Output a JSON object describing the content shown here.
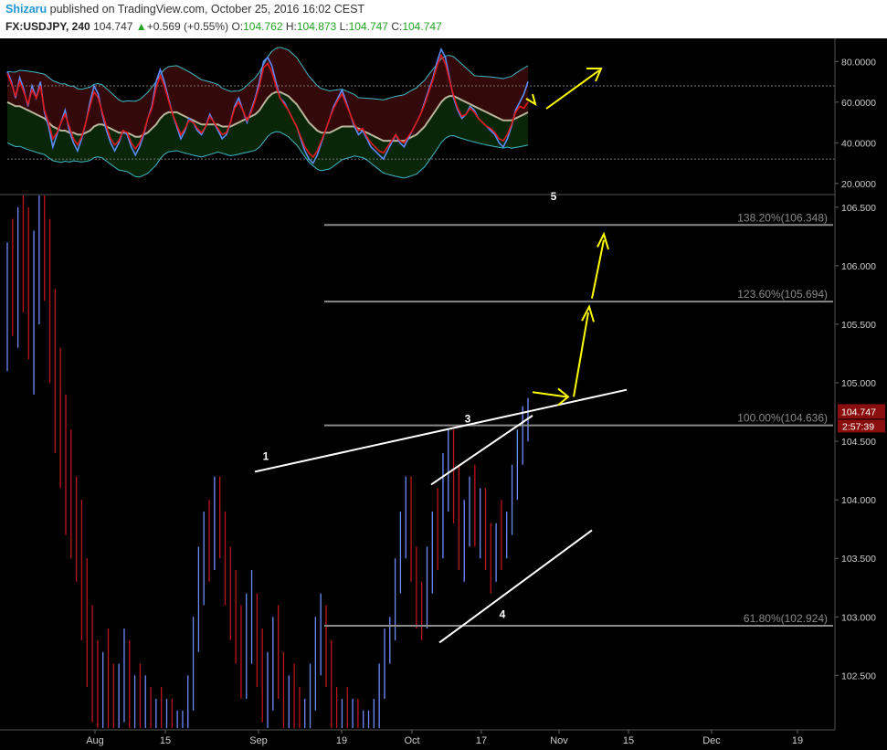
{
  "header": {
    "author": "Shizaru",
    "published_text": "published on TradingView.com, October 25, 2016 16:02 CEST",
    "symbol": "FX:USDJPY, 240",
    "last": "104.747",
    "change": "+0.569 (+0.55%)",
    "o_label": "O:",
    "o_value": "104.762",
    "h_label": "H:",
    "h_value": "104.873",
    "l_label": "L:",
    "l_value": "104.747",
    "c_label": "C:",
    "c_value": "104.747"
  },
  "chart_data": [
    {
      "type": "line",
      "description_none": "",
      "y_ticks": [
        "80.0000",
        "60.0000",
        "40.0000",
        "20.0000"
      ],
      "ylim": [
        15,
        90
      ],
      "levels": [
        68,
        32
      ],
      "series": [
        {
          "values": [
            75,
            70,
            62,
            72,
            66,
            58,
            68,
            62,
            70,
            55,
            48,
            38,
            44,
            50,
            56,
            46,
            40,
            36,
            42,
            50,
            60,
            68,
            64,
            54,
            46,
            40,
            36,
            40,
            46,
            44,
            38,
            34,
            38,
            44,
            52,
            58,
            70,
            76,
            70,
            62,
            54,
            48,
            42,
            46,
            52,
            50,
            46,
            44,
            48,
            54,
            50,
            46,
            42,
            44,
            50,
            58,
            62,
            56,
            50,
            56,
            62,
            70,
            80,
            82,
            78,
            70,
            62,
            60,
            56,
            52,
            48,
            42,
            36,
            32,
            30,
            34,
            40,
            46,
            52,
            58,
            62,
            66,
            60,
            54,
            48,
            44,
            46,
            42,
            38,
            36,
            34,
            32,
            36,
            40,
            44,
            40,
            38,
            42,
            46,
            50,
            54,
            60,
            66,
            72,
            80,
            86,
            82,
            72,
            62,
            56,
            52,
            54,
            58,
            56,
            52,
            50,
            48,
            46,
            44,
            40,
            38,
            42,
            48,
            56,
            60,
            64,
            70
          ]
        },
        {
          "values": [
            74,
            69,
            63,
            70,
            65,
            59,
            66,
            62,
            68,
            56,
            50,
            42,
            45,
            50,
            54,
            48,
            42,
            39,
            43,
            50,
            58,
            65,
            62,
            55,
            48,
            42,
            39,
            41,
            46,
            45,
            40,
            37,
            40,
            45,
            52,
            57,
            67,
            73,
            68,
            61,
            54,
            49,
            44,
            47,
            51,
            50,
            47,
            45,
            48,
            53,
            50,
            47,
            44,
            45,
            50,
            57,
            60,
            56,
            51,
            55,
            61,
            68,
            77,
            79,
            75,
            68,
            62,
            59,
            56,
            52,
            48,
            43,
            38,
            35,
            33,
            36,
            41,
            46,
            52,
            57,
            61,
            64,
            59,
            54,
            49,
            46,
            47,
            43,
            40,
            38,
            36,
            35,
            38,
            41,
            44,
            41,
            40,
            43,
            46,
            50,
            54,
            59,
            65,
            71,
            78,
            83,
            79,
            71,
            63,
            57,
            53,
            54,
            57,
            55,
            52,
            50,
            48,
            47,
            45,
            42,
            41,
            44,
            49,
            55,
            58,
            57,
            60
          ]
        },
        {
          "values": [
            60,
            59,
            58,
            58,
            57,
            56,
            55,
            54,
            53,
            52,
            50,
            48,
            47,
            46,
            46,
            45,
            45,
            44,
            44,
            45,
            46,
            48,
            49,
            49,
            48,
            47,
            46,
            45,
            45,
            45,
            44,
            43,
            43,
            44,
            45,
            47,
            49,
            52,
            54,
            55,
            55,
            55,
            54,
            53,
            52,
            51,
            50,
            49,
            49,
            49,
            49,
            49,
            48,
            48,
            48,
            49,
            50,
            51,
            52,
            53,
            54,
            56,
            59,
            62,
            64,
            65,
            65,
            64,
            63,
            61,
            59,
            56,
            53,
            50,
            48,
            46,
            45,
            45,
            45,
            46,
            47,
            48,
            48,
            48,
            48,
            47,
            46,
            45,
            44,
            43,
            42,
            41,
            41,
            41,
            41,
            41,
            41,
            42,
            43,
            44,
            46,
            48,
            51,
            54,
            57,
            60,
            62,
            63,
            63,
            62,
            61,
            60,
            59,
            58,
            57,
            56,
            55,
            54,
            53,
            52,
            51,
            51,
            51,
            52,
            53,
            54,
            55
          ]
        }
      ]
    },
    {
      "type": "bar",
      "subtype": "ohlc",
      "x_ticks": [
        "Aug",
        "15",
        "Sep",
        "19",
        "Oct",
        "17",
        "Nov",
        "15",
        "Dec",
        "19"
      ],
      "y_ticks": [
        "106.500",
        "106.000",
        "105.500",
        "105.000",
        "104.500",
        "104.000",
        "103.500",
        "103.000",
        "102.500"
      ],
      "ylim": [
        102.05,
        106.6
      ],
      "last_price_label": "104.747",
      "countdown_label": "2:57:39",
      "wave_labels": [
        "1",
        "3",
        "4",
        "5"
      ],
      "fib_levels": [
        {
          "label": "138.20%(106.348)",
          "value": 106.348
        },
        {
          "label": "123.60%(105.694)",
          "value": 105.694
        },
        {
          "label": "100.00%(104.636)",
          "value": 104.636
        },
        {
          "label": "61.80%(102.924)",
          "value": 102.924
        }
      ],
      "colors": {
        "up": "#6f8dff",
        "down": "#c0141c",
        "annotation": "#ffff00"
      },
      "ohlc": [
        [
          105.5,
          106.2,
          105.1,
          105.9
        ],
        [
          105.9,
          106.4,
          105.4,
          105.7
        ],
        [
          105.7,
          106.5,
          105.3,
          106.2
        ],
        [
          106.2,
          106.6,
          105.6,
          105.8
        ],
        [
          105.8,
          106.5,
          105.2,
          105.4
        ],
        [
          105.4,
          106.3,
          104.9,
          106.0
        ],
        [
          106.0,
          106.6,
          105.5,
          106.3
        ],
        [
          106.3,
          106.6,
          105.7,
          105.9
        ],
        [
          105.9,
          106.4,
          105.0,
          105.2
        ],
        [
          105.2,
          105.8,
          104.4,
          104.8
        ],
        [
          104.8,
          105.3,
          104.1,
          104.4
        ],
        [
          104.4,
          104.9,
          103.7,
          104.1
        ],
        [
          104.1,
          104.6,
          103.5,
          103.9
        ],
        [
          103.9,
          104.2,
          103.3,
          103.6
        ],
        [
          103.6,
          104.0,
          102.8,
          103.1
        ],
        [
          103.1,
          103.5,
          102.4,
          102.7
        ],
        [
          102.7,
          103.1,
          102.1,
          102.4
        ],
        [
          102.4,
          102.8,
          102.05,
          102.3
        ],
        [
          102.3,
          102.7,
          102.05,
          102.5
        ],
        [
          102.5,
          102.9,
          102.05,
          102.3
        ],
        [
          102.3,
          102.6,
          102.05,
          102.2
        ],
        [
          102.2,
          102.6,
          102.05,
          102.4
        ],
        [
          102.4,
          102.9,
          102.1,
          102.6
        ],
        [
          102.6,
          102.8,
          102.05,
          102.2
        ],
        [
          102.2,
          102.5,
          102.05,
          102.3
        ],
        [
          102.3,
          102.6,
          102.05,
          102.2
        ],
        [
          102.2,
          102.5,
          102.05,
          102.3
        ],
        [
          102.3,
          102.4,
          102.05,
          102.1
        ],
        [
          102.1,
          102.3,
          102.05,
          102.2
        ],
        [
          102.2,
          102.4,
          102.05,
          102.1
        ],
        [
          102.1,
          102.3,
          102.05,
          102.2
        ],
        [
          102.2,
          102.3,
          102.05,
          102.1
        ],
        [
          102.1,
          102.2,
          102.05,
          102.1
        ],
        [
          102.1,
          102.2,
          102.05,
          102.1
        ],
        [
          102.1,
          102.5,
          102.05,
          102.4
        ],
        [
          102.4,
          103.0,
          102.2,
          102.9
        ],
        [
          102.9,
          103.6,
          102.7,
          103.4
        ],
        [
          103.4,
          103.9,
          103.1,
          103.7
        ],
        [
          103.7,
          104.0,
          103.3,
          103.5
        ],
        [
          103.5,
          104.2,
          103.4,
          104.0
        ],
        [
          104.0,
          104.2,
          103.5,
          103.7
        ],
        [
          103.7,
          103.9,
          103.1,
          103.3
        ],
        [
          103.3,
          103.6,
          102.8,
          103.0
        ],
        [
          103.0,
          103.4,
          102.6,
          102.8
        ],
        [
          102.8,
          103.1,
          102.3,
          102.6
        ],
        [
          102.6,
          103.2,
          102.3,
          102.9
        ],
        [
          102.9,
          103.4,
          102.6,
          103.1
        ],
        [
          103.1,
          103.2,
          102.4,
          102.6
        ],
        [
          102.6,
          102.9,
          102.1,
          102.3
        ],
        [
          102.3,
          102.7,
          102.05,
          102.5
        ],
        [
          102.5,
          103.0,
          102.2,
          102.8
        ],
        [
          102.8,
          103.1,
          102.3,
          102.5
        ],
        [
          102.5,
          102.7,
          102.05,
          102.2
        ],
        [
          102.2,
          102.5,
          102.05,
          102.3
        ],
        [
          102.3,
          102.6,
          102.05,
          102.2
        ],
        [
          102.2,
          102.4,
          102.05,
          102.1
        ],
        [
          102.1,
          102.3,
          102.05,
          102.2
        ],
        [
          102.2,
          102.6,
          102.05,
          102.4
        ],
        [
          102.4,
          103.0,
          102.2,
          102.8
        ],
        [
          102.8,
          103.2,
          102.5,
          102.9
        ],
        [
          102.9,
          103.1,
          102.4,
          102.6
        ],
        [
          102.6,
          102.8,
          102.05,
          102.2
        ],
        [
          102.2,
          102.4,
          102.05,
          102.1
        ],
        [
          102.1,
          102.3,
          102.05,
          102.2
        ],
        [
          102.2,
          102.4,
          102.05,
          102.1
        ],
        [
          102.1,
          102.3,
          102.05,
          102.2
        ],
        [
          102.2,
          102.3,
          102.05,
          102.1
        ],
        [
          102.1,
          102.2,
          102.05,
          102.1
        ],
        [
          102.1,
          102.2,
          102.05,
          102.1
        ],
        [
          102.1,
          102.3,
          102.05,
          102.2
        ],
        [
          102.2,
          102.6,
          102.05,
          102.5
        ],
        [
          102.5,
          102.9,
          102.3,
          102.8
        ],
        [
          102.8,
          103.0,
          102.6,
          102.9
        ],
        [
          102.9,
          103.5,
          102.8,
          103.4
        ],
        [
          103.4,
          103.9,
          103.2,
          103.7
        ],
        [
          103.7,
          104.2,
          103.5,
          104.0
        ],
        [
          104.0,
          104.2,
          103.3,
          103.5
        ],
        [
          103.5,
          103.6,
          102.9,
          103.1
        ],
        [
          103.1,
          103.3,
          102.8,
          102.9
        ],
        [
          102.9,
          103.6,
          102.9,
          103.4
        ],
        [
          103.4,
          103.9,
          103.2,
          103.8
        ],
        [
          103.8,
          104.1,
          103.4,
          103.6
        ],
        [
          103.6,
          104.4,
          103.5,
          104.2
        ],
        [
          104.2,
          104.6,
          103.9,
          104.4
        ],
        [
          104.4,
          104.6,
          103.8,
          104.0
        ],
        [
          104.0,
          104.3,
          103.4,
          103.6
        ],
        [
          103.6,
          104.0,
          103.3,
          103.8
        ],
        [
          103.8,
          104.2,
          103.6,
          104.1
        ],
        [
          104.1,
          104.3,
          103.6,
          103.8
        ],
        [
          103.8,
          104.1,
          103.5,
          103.9
        ],
        [
          103.9,
          104.1,
          103.4,
          103.6
        ],
        [
          103.6,
          103.8,
          103.2,
          103.4
        ],
        [
          103.4,
          103.8,
          103.3,
          103.7
        ],
        [
          103.7,
          104.0,
          103.4,
          103.6
        ],
        [
          103.6,
          103.9,
          103.5,
          103.8
        ],
        [
          103.8,
          104.3,
          103.7,
          104.2
        ],
        [
          104.2,
          104.6,
          104.0,
          104.5
        ],
        [
          104.5,
          104.8,
          104.3,
          104.6
        ],
        [
          104.6,
          104.87,
          104.5,
          104.75
        ]
      ]
    }
  ]
}
